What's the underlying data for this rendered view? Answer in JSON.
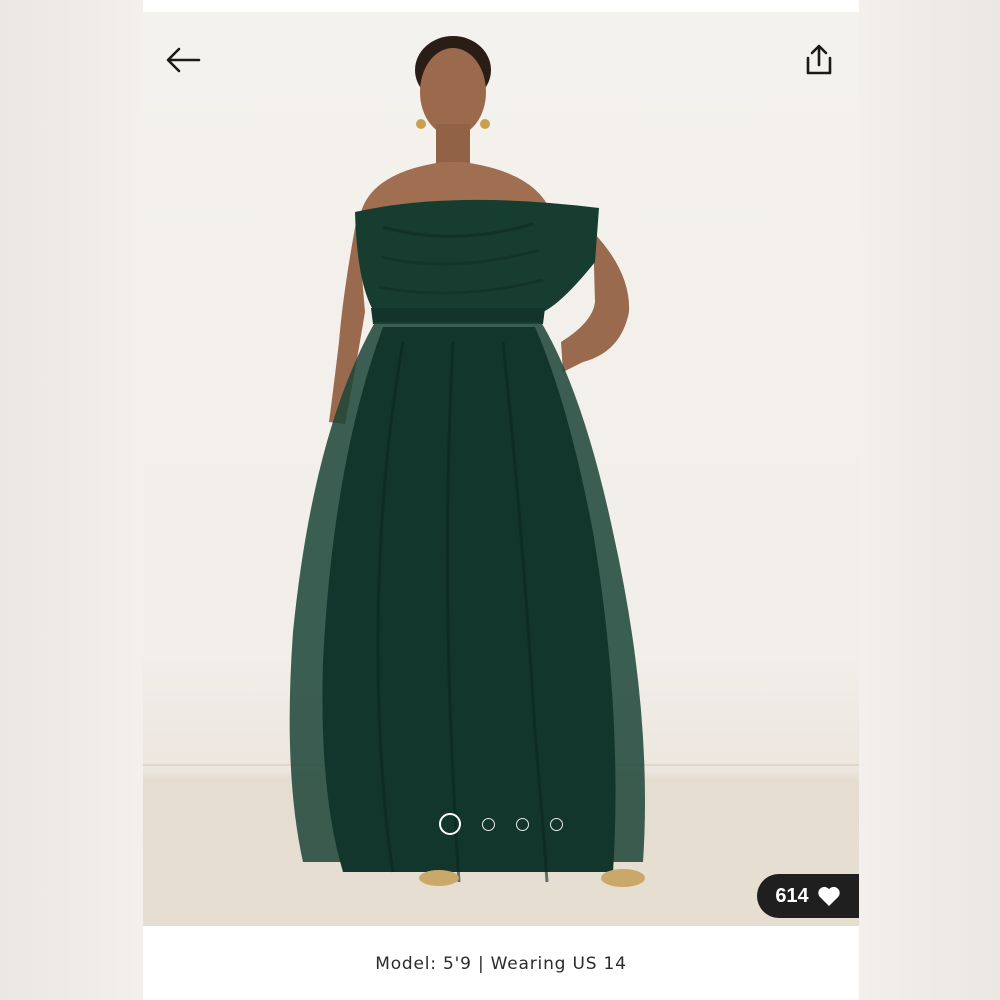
{
  "header": {
    "back_icon": "arrow-left-icon",
    "share_icon": "share-upload-icon"
  },
  "gallery": {
    "image_description": "",
    "total_images": 4,
    "active_index": 0,
    "indicator_color": "#ffffff"
  },
  "likes": {
    "count": "614",
    "icon": "heart-icon",
    "pill_color": "#1f1f1f"
  },
  "caption": {
    "text": "Model: 5'9 | Wearing US 14"
  },
  "colors": {
    "dress": "#163b30",
    "background": "#f3f0ec",
    "floor": "#e7ded2"
  }
}
